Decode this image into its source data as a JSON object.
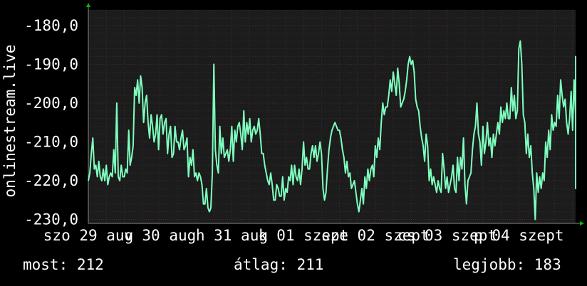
{
  "chart_data": {
    "type": "line",
    "ylabel": "onlinestream.live",
    "ylim": [
      -231,
      -176
    ],
    "yticks": [
      -180,
      -190,
      -200,
      -210,
      -220,
      -230
    ],
    "ytick_labels": [
      "-180,0",
      "-190,0",
      "-200,0",
      "-210,0",
      "-220,0",
      "-230,0"
    ],
    "xlim": [
      0,
      163
    ],
    "xticks": [
      {
        "x": 0,
        "label": "szo 29 aug"
      },
      {
        "x": 24,
        "label": "v 30 aug"
      },
      {
        "x": 48,
        "label": "h 31 aug"
      },
      {
        "x": 72,
        "label": "k 01 szept"
      },
      {
        "x": 96,
        "label": "sze 02 szept"
      },
      {
        "x": 120,
        "label": "cs 03 szept"
      },
      {
        "x": 144,
        "label": "p 04 szept"
      }
    ],
    "grid": true,
    "colors": {
      "line": "#7fffbf",
      "background": "#000000",
      "plot_bg": "#1c1c1c",
      "grid": "#3a3a3a",
      "axis_arrow": "#00c000"
    },
    "series": [
      {
        "x_start": 0,
        "x_step": 0.5,
        "values": [
          -220,
          -218,
          -213,
          -209,
          -217,
          -216,
          -219,
          -215,
          -219,
          -220,
          -217,
          -220,
          -216,
          -221,
          -219,
          -218,
          -219,
          -212,
          -218,
          -200,
          -219,
          -220,
          -216,
          -219,
          -219,
          -217,
          -218,
          -207,
          -216,
          -214,
          -211,
          -196,
          -198,
          -194,
          -200,
          -193,
          -196,
          -205,
          -200,
          -198,
          -205,
          -209,
          -203,
          -206,
          -210,
          -208,
          -203,
          -212,
          -204,
          -203,
          -208,
          -205,
          -204,
          -213,
          -208,
          -206,
          -214,
          -213,
          -206,
          -210,
          -210,
          -212,
          -209,
          -207,
          -212,
          -211,
          -209,
          -219,
          -214,
          -216,
          -212,
          -219,
          -218,
          -220,
          -218,
          -219,
          -221,
          -226,
          -226,
          -222,
          -227,
          -228,
          -227,
          -218,
          -190,
          -212,
          -216,
          -218,
          -206,
          -213,
          -209,
          -214,
          -213,
          -212,
          -215,
          -212,
          -206,
          -215,
          -207,
          -210,
          -206,
          -205,
          -208,
          -212,
          -202,
          -210,
          -205,
          -208,
          -204,
          -210,
          -207,
          -206,
          -208,
          -207,
          -204,
          -208,
          -213,
          -213,
          -216,
          -218,
          -220,
          -221,
          -218,
          -221,
          -225,
          -225,
          -221,
          -222,
          -224,
          -224,
          -219,
          -225,
          -222,
          -223,
          -219,
          -220,
          -216,
          -221,
          -216,
          -219,
          -220,
          -217,
          -221,
          -217,
          -210,
          -216,
          -214,
          -217,
          -217,
          -213,
          -211,
          -214,
          -211,
          -215,
          -213,
          -210,
          -213,
          -222,
          -225,
          -223,
          -217,
          -212,
          -209,
          -207,
          -206,
          -205,
          -206,
          -207,
          -207,
          -209,
          -212,
          -214,
          -218,
          -215,
          -219,
          -218,
          -222,
          -221,
          -220,
          -223,
          -226,
          -228,
          -225,
          -222,
          -226,
          -219,
          -222,
          -217,
          -220,
          -217,
          -216,
          -219,
          -211,
          -214,
          -209,
          -212,
          -205,
          -200,
          -203,
          -201,
          -201,
          -198,
          -194,
          -197,
          -192,
          -195,
          -198,
          -191,
          -195,
          -201,
          -200,
          -199,
          -197,
          -194,
          -190,
          -188,
          -190,
          -189,
          -192,
          -199,
          -201,
          -202,
          -206,
          -209,
          -211,
          -215,
          -208,
          -211,
          -220,
          -217,
          -221,
          -219,
          -221,
          -223,
          -220,
          -222,
          -223,
          -213,
          -217,
          -222,
          -219,
          -223,
          -221,
          -219,
          -216,
          -222,
          -223,
          -214,
          -220,
          -214,
          -217,
          -209,
          -221,
          -226,
          -220,
          -219,
          -218,
          -212,
          -208,
          -206,
          -200,
          -208,
          -210,
          -216,
          -206,
          -213,
          -210,
          -205,
          -211,
          -209,
          -214,
          -208,
          -211,
          -208,
          -205,
          -208,
          -201,
          -205,
          -202,
          -204,
          -200,
          -204,
          -204,
          -196,
          -202,
          -198,
          -204,
          -202,
          -186,
          -184,
          -190,
          -203,
          -205,
          -213,
          -208,
          -214,
          -211,
          -218,
          -222,
          -230,
          -218,
          -223,
          -219,
          -222,
          -218,
          -220,
          -210,
          -214,
          -207,
          -212,
          -203,
          -207,
          -205,
          -206,
          -198,
          -204,
          -194,
          -198,
          -201,
          -199,
          -205,
          -208,
          -204,
          -197,
          -207,
          -194,
          -203,
          -200,
          -202,
          -206,
          -197,
          -212,
          -207,
          -202,
          -209,
          -194,
          -203,
          -190,
          -200,
          -188,
          -191,
          -189,
          -196,
          -189,
          -195,
          -190,
          -189,
          -188,
          -194,
          -190,
          -192,
          -198,
          -202,
          -209,
          -211,
          -213,
          -210,
          -217,
          -218,
          -222,
          -214,
          -220,
          -219,
          -216,
          -221,
          -215,
          -218,
          -221,
          -214,
          -220,
          -215,
          -213,
          -220,
          -217,
          -221,
          -218,
          -220,
          -216,
          -215,
          -213,
          -219,
          -215,
          -208,
          -214,
          -216,
          -218,
          -221,
          -217,
          -222,
          -216,
          -220,
          -218,
          -214,
          -211,
          -210,
          -207,
          -205,
          -210,
          -204,
          -208,
          -203,
          -210,
          -203,
          -205,
          -202,
          -204,
          -203,
          -206,
          -208,
          -206,
          -212,
          -214,
          -215,
          -212,
          -213,
          -212,
          -212
        ]
      }
    ]
  },
  "stats": {
    "now": "most: 212",
    "avg": "átlag: 211",
    "best": "legjobb: 183"
  }
}
